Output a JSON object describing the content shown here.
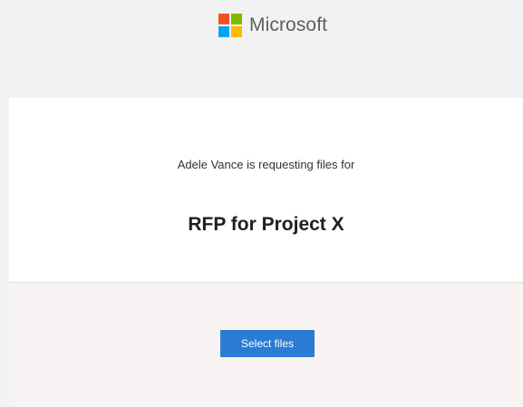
{
  "header": {
    "brand_name": "Microsoft",
    "logo_colors": [
      "#f25022",
      "#7fba00",
      "#00a4ef",
      "#ffb900"
    ]
  },
  "request": {
    "message": "Adele Vance is requesting files for",
    "project_title": "RFP for Project X"
  },
  "actions": {
    "select_files_label": "Select files",
    "button_color": "#2b7cd3"
  }
}
